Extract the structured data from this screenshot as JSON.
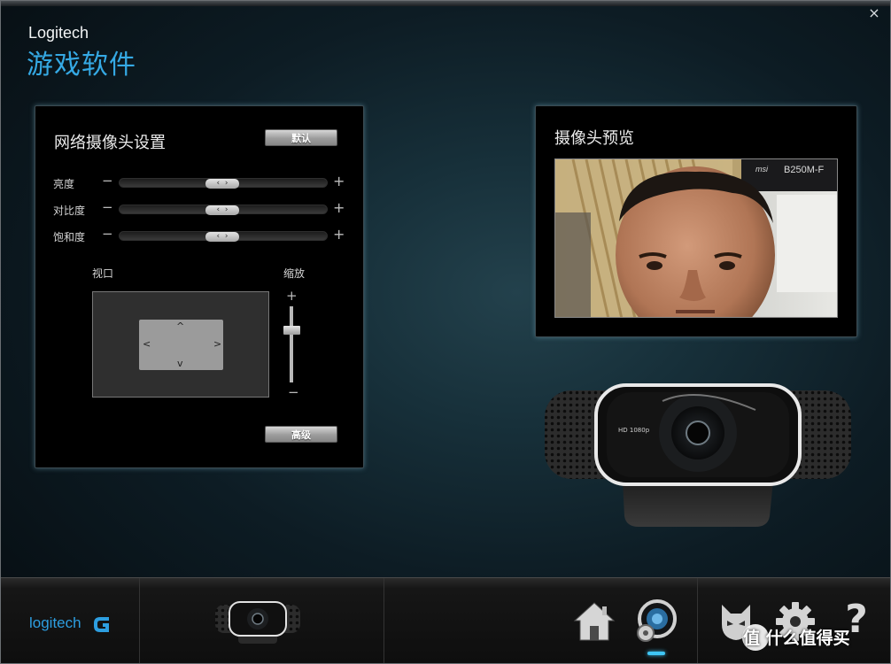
{
  "window": {
    "brand": "Logitech",
    "title": "游戏软件",
    "close_symbol": "×"
  },
  "settings_panel": {
    "title": "网络摄像头设置",
    "default_button": "默认",
    "sliders": [
      {
        "label": "亮度",
        "minus": "−",
        "plus": "+",
        "value_fraction": 0.5
      },
      {
        "label": "对比度",
        "minus": "−",
        "plus": "+",
        "value_fraction": 0.5
      },
      {
        "label": "饱和度",
        "minus": "−",
        "plus": "+",
        "value_fraction": 0.5
      }
    ],
    "viewport_label": "视口",
    "zoom_label": "缩放",
    "zoom_plus": "+",
    "zoom_minus": "−",
    "zoom_fraction": 0.25,
    "advanced_button": "高级"
  },
  "preview_panel": {
    "title": "摄像头预览",
    "background_brand": "msi",
    "background_model": "B250M-F"
  },
  "webcam_label": "HD 1080p",
  "bottom_bar": {
    "logo_text": "logitech",
    "nav": [
      "home-icon",
      "camera-settings-icon",
      "mask-icon",
      "gear-icon",
      "help-icon"
    ],
    "help_symbol": "?",
    "active_color": "#3fc6f5"
  },
  "watermark": "值 什么值得买",
  "colors": {
    "accent": "#35a9e4",
    "brand_logo": "#2d9ee0"
  }
}
